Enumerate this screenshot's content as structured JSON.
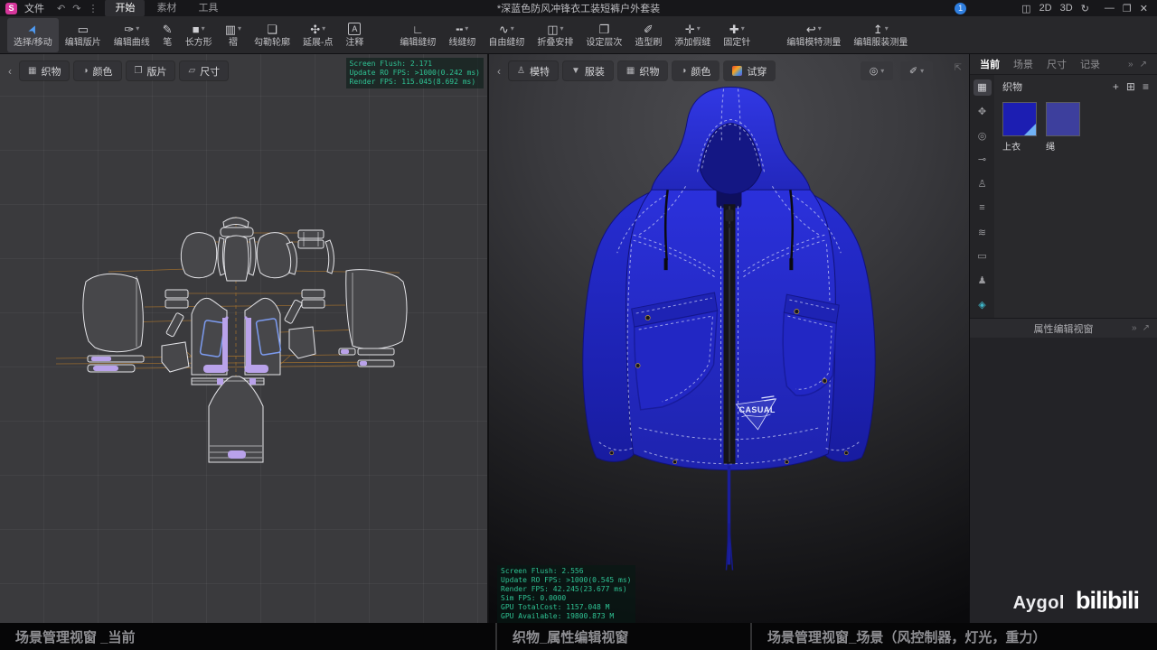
{
  "titlebar": {
    "logo_text": "S",
    "menu_file": "文件",
    "undo_glyph": "↶",
    "redo_glyph": "↷",
    "more_glyph": "⋮",
    "tabs": [
      {
        "label": "开始",
        "active": true
      },
      {
        "label": "素材",
        "active": false
      },
      {
        "label": "工具",
        "active": false
      }
    ],
    "document_title": "*深蓝色防风冲锋衣工装短裤户外套装",
    "notification_badge": "1",
    "split_view_glyph": "◫",
    "view_2d": "2D",
    "view_3d": "3D",
    "sync_glyph": "↻",
    "minimize_glyph": "—",
    "restore_glyph": "❐",
    "close_glyph": "✕"
  },
  "toolbar": {
    "groups": [
      [
        {
          "name": "select-move",
          "label": "选择/移动",
          "glyph": "➤",
          "active": true,
          "cls": "rot",
          "dropdown": false
        },
        {
          "name": "edit-pattern",
          "label": "编辑版片",
          "glyph": "▭",
          "dropdown": false
        },
        {
          "name": "edit-curve",
          "label": "编辑曲线",
          "glyph": "✑",
          "dropdown": true
        },
        {
          "name": "pen",
          "label": "笔",
          "glyph": "✎",
          "dropdown": false
        },
        {
          "name": "rectangle",
          "label": "长方形",
          "glyph": "■",
          "dropdown": true
        },
        {
          "name": "pleat",
          "label": "褶",
          "glyph": "▥",
          "dropdown": true
        },
        {
          "name": "trace-outline",
          "label": "勾勒轮廓",
          "glyph": "❏",
          "dropdown": false
        },
        {
          "name": "extend-point",
          "label": "延展-点",
          "glyph": "✣",
          "dropdown": true
        },
        {
          "name": "annotation",
          "label": "注释",
          "glyph": "A",
          "cls": "boxed",
          "dropdown": false
        }
      ],
      [
        {
          "name": "edit-sewing",
          "label": "编辑缝纫",
          "glyph": "∟",
          "dropdown": false
        },
        {
          "name": "line-sewing",
          "label": "线缝纫",
          "glyph": "╍",
          "dropdown": true
        },
        {
          "name": "free-sewing",
          "label": "自由缝纫",
          "glyph": "∿",
          "dropdown": true
        },
        {
          "name": "fold-arrange",
          "label": "折叠安排",
          "glyph": "◫",
          "dropdown": true
        },
        {
          "name": "set-layer",
          "label": "设定层次",
          "glyph": "❐",
          "dropdown": false
        },
        {
          "name": "styling-brush",
          "label": "造型刷",
          "glyph": "✐",
          "dropdown": false
        },
        {
          "name": "add-basting",
          "label": "添加假缝",
          "glyph": "✛",
          "dropdown": true
        },
        {
          "name": "pin",
          "label": "固定针",
          "glyph": "✚",
          "dropdown": true
        }
      ],
      [
        {
          "name": "edit-model-measure",
          "label": "编辑模特测量",
          "glyph": "↩",
          "dropdown": true
        },
        {
          "name": "edit-garment-measure",
          "label": "编辑服装测量",
          "glyph": "↥",
          "dropdown": true
        }
      ]
    ]
  },
  "left_viewport": {
    "collapse_glyph": "‹",
    "tabs": [
      {
        "name": "fabric",
        "label": "织物",
        "glyph": "▦"
      },
      {
        "name": "color",
        "label": "颜色",
        "glyph": "◑"
      },
      {
        "name": "pattern",
        "label": "版片",
        "glyph": "❒"
      },
      {
        "name": "size",
        "label": "尺寸",
        "glyph": "▱"
      }
    ],
    "stats": "Screen Flush: 2.171\nUpdate RO FPS: >1000(0.242 ms)\nRender FPS: 115.045(8.692 ms)"
  },
  "right_viewport": {
    "collapse_glyph": "‹",
    "tabs": [
      {
        "name": "model",
        "label": "模特",
        "glyph": "♙"
      },
      {
        "name": "garment",
        "label": "服装",
        "glyph": "▼"
      },
      {
        "name": "fabric",
        "label": "织物",
        "glyph": "▦"
      },
      {
        "name": "color",
        "label": "颜色",
        "glyph": "◑"
      },
      {
        "name": "try-on",
        "label": "试穿",
        "glyph": "",
        "swatch": true
      }
    ],
    "view_buttons": [
      {
        "name": "render-mode",
        "glyph": "◎"
      },
      {
        "name": "brush-mode",
        "glyph": "✐"
      }
    ],
    "expand_glyph": "⇱",
    "stats": "Screen Flush: 2.556\nUpdate RO FPS: >1000(0.545 ms)\nRender FPS: 42.245(23.677 ms)\nSim FPS: 0.0000\nGPU TotalCost: 1157.048 M\nGPU Available: 19800.873 M",
    "badge_line1": "CASUAL"
  },
  "right_panel": {
    "tabs": [
      {
        "label": "当前",
        "active": true
      },
      {
        "label": "场景",
        "active": false
      },
      {
        "label": "尺寸",
        "active": false
      },
      {
        "label": "记录",
        "active": false
      }
    ],
    "collapse_glyph": "»",
    "expand_glyph": "↗",
    "strip_icons": [
      {
        "name": "fabric",
        "glyph": "▦",
        "active": true
      },
      {
        "name": "trim",
        "glyph": "✥",
        "active": false
      },
      {
        "name": "button",
        "glyph": "◎",
        "active": false
      },
      {
        "name": "zipper",
        "glyph": "⊸",
        "active": false
      },
      {
        "name": "mannequin",
        "glyph": "♙",
        "active": false
      },
      {
        "name": "topstitch",
        "glyph": "≡",
        "active": false
      },
      {
        "name": "shirring",
        "glyph": "≋",
        "active": false
      },
      {
        "name": "piping",
        "glyph": "▭",
        "active": false
      },
      {
        "name": "avatar",
        "glyph": "♟",
        "active": false
      }
    ],
    "scene_cube": {
      "name": "scene-cube",
      "glyph": "◈",
      "color": "#3fb6c9"
    },
    "fabric_section": {
      "title": "织物",
      "add_glyph": "+",
      "grid_glyph": "⊞",
      "menu_glyph": "≡",
      "swatches": [
        {
          "label": "上衣",
          "color": "#1c1eb2",
          "selected": true
        },
        {
          "label": "绳",
          "color": "#3d3f9d",
          "selected": false
        }
      ]
    },
    "property_panel_title": "属性编辑视窗"
  },
  "bottom_bar": {
    "sections": [
      {
        "label": "场景管理视窗 _当前"
      },
      {
        "label": "织物_属性编辑视窗"
      },
      {
        "label": "场景管理视窗_场景（风控制器，灯光，重力）"
      }
    ]
  },
  "watermark": {
    "author": "Aygol",
    "site": "bilibili"
  },
  "colors": {
    "jacket_blue": "#262bd0",
    "stats_green": "#2fc394",
    "logo_pink": "#d6369b",
    "swatch_fold": "#6fb1f5"
  }
}
